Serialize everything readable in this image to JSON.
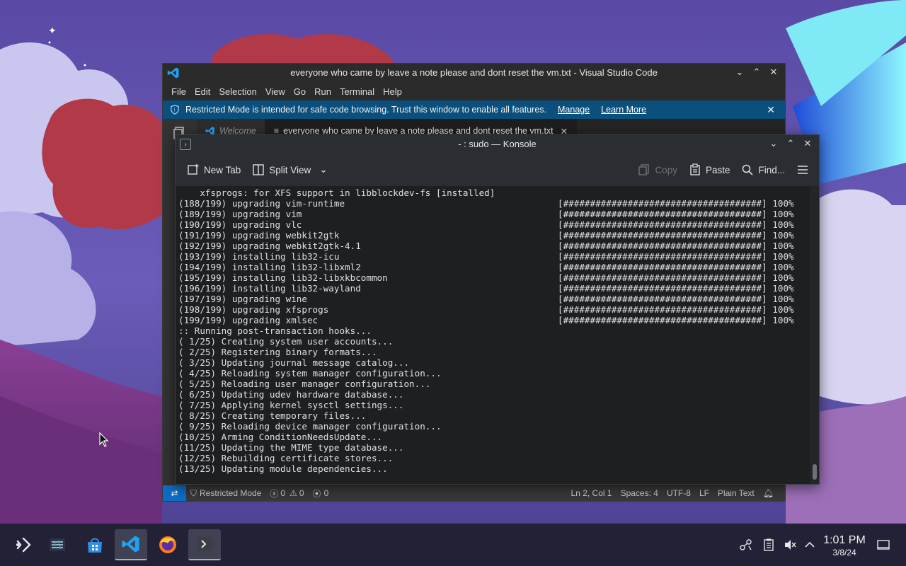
{
  "vscode": {
    "title": "everyone who came by leave a note please and dont reset the vm.txt - Visual Studio Code",
    "menu": [
      "File",
      "Edit",
      "Selection",
      "View",
      "Go",
      "Run",
      "Terminal",
      "Help"
    ],
    "banner": {
      "text": "Restricted Mode is intended for safe code browsing. Trust this window to enable all features.",
      "manage": "Manage",
      "learn_more": "Learn More"
    },
    "tabs": [
      {
        "label": "Welcome"
      },
      {
        "label": "everyone who came by leave a note please and dont reset the vm.txt"
      }
    ],
    "status": {
      "restricted": "Restricted Mode",
      "errors": "0",
      "warnings": "0",
      "ports": "0",
      "position": "Ln 2, Col 1",
      "spaces": "Spaces: 4",
      "encoding": "UTF-8",
      "eol": "LF",
      "language": "Plain Text"
    }
  },
  "konsole": {
    "title": "- : sudo — Konsole",
    "toolbar": {
      "new_tab": "New Tab",
      "split_view": "Split View",
      "copy": "Copy",
      "paste": "Paste",
      "find": "Find..."
    },
    "lines": [
      {
        "text": "    xfsprogs: for XFS support in libblockdev-fs [installed]",
        "bar": ""
      },
      {
        "text": "(188/199) upgrading vim-runtime",
        "bar": "[#####################################] 100%"
      },
      {
        "text": "(189/199) upgrading vim",
        "bar": "[#####################################] 100%"
      },
      {
        "text": "(190/199) upgrading vlc",
        "bar": "[#####################################] 100%"
      },
      {
        "text": "(191/199) upgrading webkit2gtk",
        "bar": "[#####################################] 100%"
      },
      {
        "text": "(192/199) upgrading webkit2gtk-4.1",
        "bar": "[#####################################] 100%"
      },
      {
        "text": "(193/199) installing lib32-icu",
        "bar": "[#####################################] 100%"
      },
      {
        "text": "(194/199) installing lib32-libxml2",
        "bar": "[#####################################] 100%"
      },
      {
        "text": "(195/199) installing lib32-libxkbcommon",
        "bar": "[#####################################] 100%"
      },
      {
        "text": "(196/199) installing lib32-wayland",
        "bar": "[#####################################] 100%"
      },
      {
        "text": "(197/199) upgrading wine",
        "bar": "[#####################################] 100%"
      },
      {
        "text": "(198/199) upgrading xfsprogs",
        "bar": "[#####################################] 100%"
      },
      {
        "text": "(199/199) upgrading xmlsec",
        "bar": "[#####################################] 100%"
      },
      {
        "text": ":: Running post-transaction hooks...",
        "bar": ""
      },
      {
        "text": "( 1/25) Creating system user accounts...",
        "bar": ""
      },
      {
        "text": "( 2/25) Registering binary formats...",
        "bar": ""
      },
      {
        "text": "( 3/25) Updating journal message catalog...",
        "bar": ""
      },
      {
        "text": "( 4/25) Reloading system manager configuration...",
        "bar": ""
      },
      {
        "text": "( 5/25) Reloading user manager configuration...",
        "bar": ""
      },
      {
        "text": "( 6/25) Updating udev hardware database...",
        "bar": ""
      },
      {
        "text": "( 7/25) Applying kernel sysctl settings...",
        "bar": ""
      },
      {
        "text": "( 8/25) Creating temporary files...",
        "bar": ""
      },
      {
        "text": "( 9/25) Reloading device manager configuration...",
        "bar": ""
      },
      {
        "text": "(10/25) Arming ConditionNeedsUpdate...",
        "bar": ""
      },
      {
        "text": "(11/25) Updating the MIME type database...",
        "bar": ""
      },
      {
        "text": "(12/25) Rebuilding certificate stores...",
        "bar": ""
      },
      {
        "text": "(13/25) Updating module dependencies...",
        "bar": ""
      }
    ]
  },
  "taskbar": {
    "apps": [
      {
        "icon": "app-launcher-icon"
      },
      {
        "icon": "system-settings-icon"
      },
      {
        "icon": "discover-store-icon"
      },
      {
        "icon": "vscode-icon",
        "active": true
      },
      {
        "icon": "firefox-icon"
      },
      {
        "icon": "konsole-icon",
        "active": true
      }
    ],
    "tray": [
      "network-icon",
      "clipboard-icon",
      "volume-muted-icon",
      "tray-expand-icon"
    ],
    "time": "1:01 PM",
    "date": "3/8/24"
  },
  "colors": {
    "vscode_banner": "#0b4f7c",
    "vscode_remote": "#0e6cc4",
    "konsole_bg": "#1d1f21"
  }
}
